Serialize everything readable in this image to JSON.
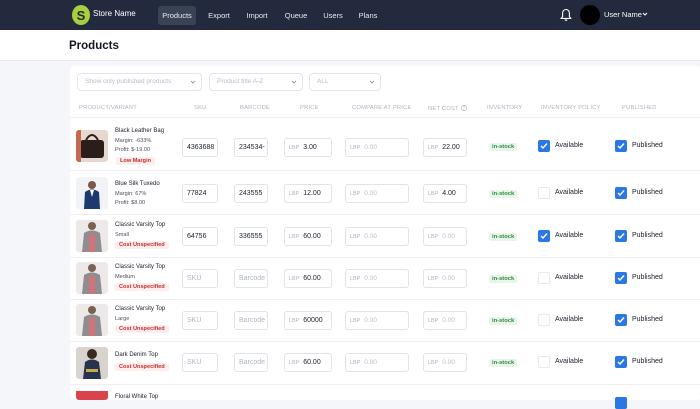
{
  "nav": {
    "logo_letter": "S",
    "store_name": "Store Name",
    "items": [
      "Products",
      "Export",
      "Import",
      "Queue",
      "Users",
      "Plans"
    ],
    "active": "Products",
    "user_name": "User Name"
  },
  "page": {
    "title": "Products"
  },
  "filters": {
    "published": "Show only published products",
    "sort": "Product title A-Z",
    "all": "ALL"
  },
  "columns": [
    "PRODUCT/VARIANT",
    "SKU",
    "BARCODE",
    "PRICE",
    "COMPARE AT PRICE",
    "NET COST",
    "INVENTORY",
    "INVENTORY POLICY",
    "PUBLISHED"
  ],
  "currency": "LBP",
  "placeholders": {
    "sku": "SKU",
    "barcode": "Barcode",
    "compare": "0.00",
    "cost": "0.00"
  },
  "rows": [
    {
      "name": "Black Leather Bag",
      "line2": "Margin: -633%",
      "line3": "Profit: $-19.00",
      "tag": "Low Margin",
      "sku": "4363688",
      "barcode": "234534-",
      "price": "3.00",
      "compare": "",
      "cost": "22.00",
      "inventory": "in-stock",
      "policy_checked": true,
      "policy": "Available",
      "published_checked": true,
      "published": "Published"
    },
    {
      "name": "Blue Silk Tuxedo",
      "line2": "Margin: 67%",
      "line3": "Profit: $8.00",
      "tag": "",
      "sku": "77824",
      "barcode": "243555",
      "price": "12.00",
      "compare": "",
      "cost": "4.00",
      "inventory": "in-stock",
      "policy_checked": false,
      "policy": "Available",
      "published_checked": true,
      "published": "Published"
    },
    {
      "name": "Classic Varsity Top",
      "line2": "Small",
      "line3": "",
      "tag": "Cost Unspecified",
      "sku": "64756",
      "barcode": "336555",
      "price": "60.00",
      "compare": "",
      "cost": "",
      "inventory": "in-stock",
      "policy_checked": true,
      "policy": "Available",
      "published_checked": true,
      "published": "Published"
    },
    {
      "name": "Classic Varsity Top",
      "line2": "Medium",
      "line3": "",
      "tag": "Cost Unspecified",
      "sku": "",
      "barcode": "",
      "price": "60.00",
      "compare": "",
      "cost": "",
      "inventory": "in-stock",
      "policy_checked": false,
      "policy": "Available",
      "published_checked": true,
      "published": "Published"
    },
    {
      "name": "Classic Varsity Top",
      "line2": "Large",
      "line3": "",
      "tag": "Cost Unspecified",
      "sku": "",
      "barcode": "",
      "price": "60000",
      "compare": "",
      "cost": "",
      "inventory": "in-stock",
      "policy_checked": false,
      "policy": "Available",
      "published_checked": true,
      "published": "Published"
    },
    {
      "name": "Dark Denim Top",
      "line2": "",
      "line3": "",
      "tag": "Cost Unspecified",
      "sku": "",
      "barcode": "",
      "price": "60.00",
      "compare": "",
      "cost": "",
      "inventory": "in-stock",
      "policy_checked": false,
      "policy": "Available",
      "published_checked": true,
      "published": "Published"
    },
    {
      "name": "Floral White Top",
      "line2": "",
      "line3": "",
      "tag": "",
      "sku": "",
      "barcode": "",
      "price": "",
      "compare": "",
      "cost": "",
      "inventory": "",
      "policy_checked": false,
      "policy": "",
      "published_checked": true,
      "published": ""
    }
  ]
}
